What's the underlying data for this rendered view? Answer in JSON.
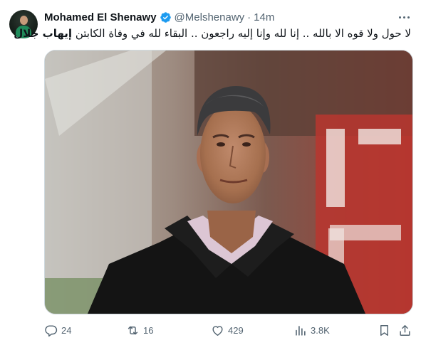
{
  "tweet": {
    "author_name": "Mohamed El Shenawy",
    "handle": "@Melshenawy",
    "separator": "·",
    "time": "14m",
    "text_prefix": "لا حول ولا قوه الا بالله .. إنا لله وإنا إليه راجعون .. البقاء لله في وفاة الكابتن ",
    "text_bold": "إيهاب جلال",
    "stats": {
      "replies": "24",
      "reposts": "16",
      "likes": "429",
      "views": "3.8K"
    }
  },
  "colors": {
    "verified_blue": "#1d9bf0",
    "secondary_text": "#536471",
    "border": "#cfd9de"
  },
  "icons": [
    "verified-badge-icon",
    "more-icon",
    "reply-icon",
    "repost-icon",
    "like-icon",
    "views-icon",
    "bookmark-icon",
    "share-icon"
  ]
}
